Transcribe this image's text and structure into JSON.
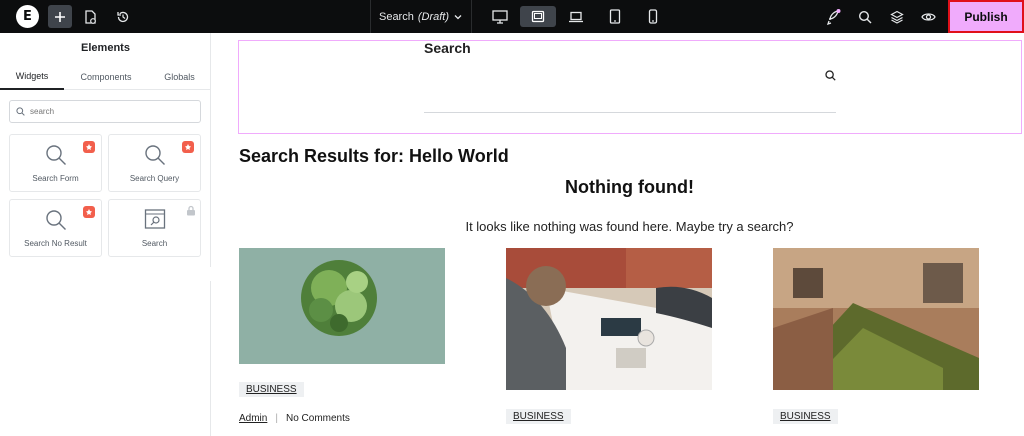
{
  "topbar": {
    "doc_name": "Search",
    "doc_state": "(Draft)",
    "publish_label": "Publish",
    "accent": "#f0abfc"
  },
  "panel": {
    "title": "Elements",
    "tabs": [
      "Widgets",
      "Components",
      "Globals"
    ],
    "search_placeholder": "search",
    "widgets": [
      {
        "label": "Search Form",
        "icon": "search-icon",
        "pro": true
      },
      {
        "label": "Search Query",
        "icon": "search-icon",
        "pro": true
      },
      {
        "label": "Search No Result",
        "icon": "search-icon",
        "pro": true
      },
      {
        "label": "Search",
        "icon": "search-box-icon",
        "locked": true
      }
    ]
  },
  "canvas": {
    "search_widget_heading": "Search",
    "results_title": "Search Results for: Hello World",
    "nothing_title": "Nothing found!",
    "nothing_text": "It looks like nothing was found here. Maybe try a search?",
    "cards": [
      {
        "category": "BUSINESS",
        "author": "Admin",
        "comments": "No Comments"
      },
      {
        "category": "BUSINESS"
      },
      {
        "category": "BUSINESS"
      }
    ]
  }
}
